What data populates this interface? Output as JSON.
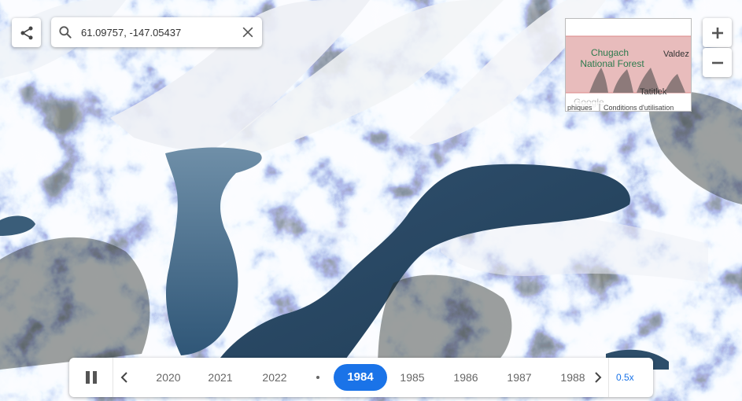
{
  "search": {
    "value": "61.09757, -147.05437"
  },
  "minimap": {
    "area_label": "Chugach National Forest",
    "place_label_1": "Valdez",
    "place_label_2": "Tatitlek",
    "attribution_partial": "phiques",
    "terms_label": "Conditions d'utilisation",
    "logo_text": "Google"
  },
  "timeline": {
    "years": [
      "2020",
      "2021",
      "2022",
      "1984",
      "1985",
      "1986",
      "1987",
      "1988"
    ],
    "active_year": "1984",
    "speed": "0.5x"
  },
  "colors": {
    "accent": "#1a73e8",
    "water": "#35597a",
    "snow": "#eef2f7",
    "rock": "#3f4540",
    "minimap_fill": "#e3b5b5"
  }
}
